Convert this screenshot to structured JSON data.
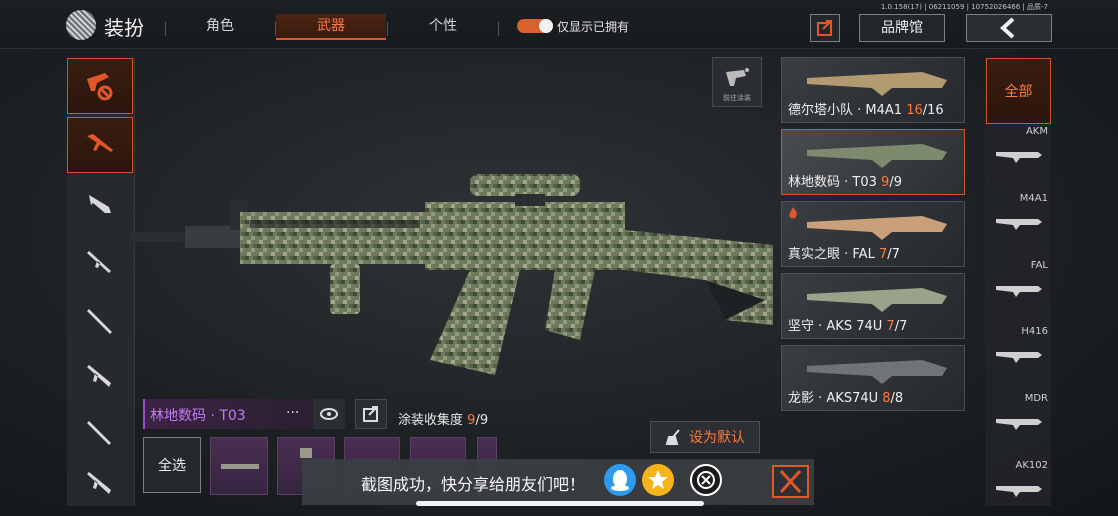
{
  "header": {
    "version": "1.0.158(17) | 06211059 | 10752026466 | 品质-7",
    "title": "装扮",
    "tabs": [
      {
        "label": "角色",
        "active": false
      },
      {
        "label": "武器",
        "active": true
      },
      {
        "label": "个性",
        "active": false
      }
    ],
    "toggle": {
      "label": "仅显示已拥有",
      "on": true
    },
    "brand_button": "品牌馆"
  },
  "paint_shortcut": {
    "label": "前往涂装"
  },
  "left_categories": [
    {
      "icon": "weapon-category-icon",
      "active": false
    },
    {
      "icon": "assault-rifle-icon",
      "active": true
    },
    {
      "icon": "smg-icon",
      "active": false
    },
    {
      "icon": "shotgun-icon",
      "active": false
    },
    {
      "icon": "sniper-rifle-icon",
      "active": false
    },
    {
      "icon": "marksman-rifle-icon",
      "active": false
    },
    {
      "icon": "pistol-icon",
      "active": false
    },
    {
      "icon": "launcher-icon",
      "active": false
    }
  ],
  "skins": [
    {
      "name": "德尔塔小队 · M4A1",
      "owned": "16",
      "total": "/16",
      "active": false,
      "limited": false
    },
    {
      "name": "林地数码 · T03",
      "owned": "9",
      "total": "/9",
      "active": true,
      "limited": false
    },
    {
      "name": "真实之眼 · FAL",
      "owned": "7",
      "total": "/7",
      "active": false,
      "limited": true
    },
    {
      "name": "坚守 · AKS 74U",
      "owned": "7",
      "total": "/7",
      "active": false,
      "limited": false
    },
    {
      "name": "龙影 · AKS74U",
      "owned": "8",
      "total": "/8",
      "active": false,
      "limited": false
    }
  ],
  "filters": {
    "all_label": "全部",
    "items": [
      "AKM",
      "M4A1",
      "FAL",
      "H416",
      "MDR",
      "AK102"
    ]
  },
  "selected_skin": {
    "label": "林地数码 · T03",
    "more": "···",
    "collection_label": "涂装收集度",
    "collection_owned": "9",
    "collection_total": "/9"
  },
  "set_default_label": "设为默认",
  "select_all_label": "全选",
  "toast": {
    "message": "截图成功，快分享给朋友们吧！"
  },
  "colors": {
    "accent": "#e0582a",
    "epic": "#c17cf5"
  }
}
